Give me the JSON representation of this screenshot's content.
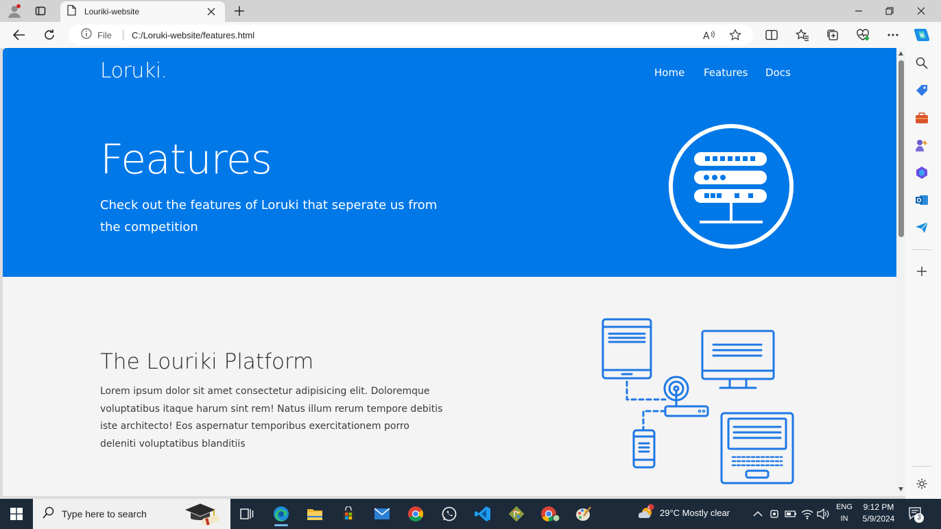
{
  "browser": {
    "tab_title": "Louriki-website",
    "address_prefix": "File",
    "url": "C:/Loruki-website/features.html"
  },
  "page": {
    "brand": "Loruki.",
    "nav": [
      "Home",
      "Features",
      "Docs"
    ],
    "hero_title": "Features",
    "hero_subtitle": "Check out the features of Loruki that seperate us from the competition",
    "section_title": "The Louriki Platform",
    "section_text": "Lorem ipsum dolor sit amet consectetur adipisicing elit. Doloremque voluptatibus itaque harum sint rem! Natus illum rerum tempore debitis iste architecto! Eos aspernatur temporibus exercitationem porro deleniti voluptatibus blanditiis"
  },
  "colors": {
    "hero_bg": "#0078e8",
    "page_bg": "#f4f4f4",
    "taskbar_bg": "#1c2a3a"
  },
  "taskbar": {
    "search_placeholder": "Type here to search",
    "weather": "29°C  Mostly clear",
    "weather_badge": "1",
    "lang_top": "ENG",
    "lang_bottom": "IN",
    "time": "9:12 PM",
    "date": "5/9/2024",
    "notifications": "3"
  },
  "icons": {
    "browser": [
      "profile-icon",
      "tab-actions-icon",
      "page-icon",
      "close-icon",
      "plus-icon",
      "minimize-icon",
      "restore-icon",
      "window-close-icon",
      "back-icon",
      "refresh-icon",
      "info-icon",
      "read-aloud-icon",
      "favorite-star-icon",
      "split-screen-icon",
      "favorites-icon",
      "collections-icon",
      "browser-essentials-icon",
      "more-icon",
      "copilot-icon"
    ],
    "sidebar": [
      "search-icon",
      "shopping-tag-icon",
      "tools-icon",
      "games-icon",
      "microsoft365-icon",
      "outlook-icon",
      "send-icon",
      "add-icon",
      "settings-icon"
    ],
    "taskbar": [
      "windows-start-icon",
      "search-icon",
      "graduation-icon",
      "task-view-icon",
      "edge-icon",
      "file-explorer-icon",
      "store-icon",
      "mail-icon",
      "chrome-icon",
      "whatsapp-icon",
      "vscode-icon",
      "git-icon",
      "chrome-profile-icon",
      "paint-icon"
    ]
  }
}
